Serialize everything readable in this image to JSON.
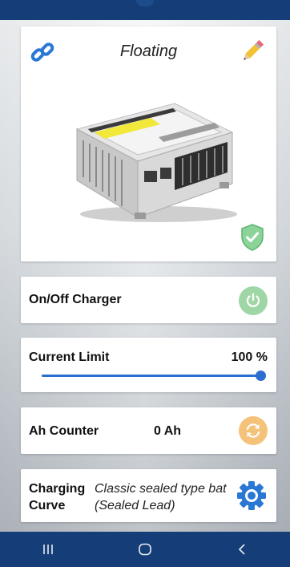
{
  "status_card": {
    "status": "Floating",
    "icons": [
      "link-icon",
      "pencil-icon",
      "shield-check-icon"
    ],
    "device_image": "battery-charger-image"
  },
  "onoff": {
    "label": "On/Off Charger",
    "icon": "power-icon",
    "color": "#9fd6a6"
  },
  "current_limit": {
    "label": "Current Limit",
    "value_text": "100 %",
    "value_percent": 100
  },
  "ah_counter": {
    "label": "Ah Counter",
    "value": "0 Ah",
    "icon": "refresh-icon",
    "color": "#f5c27a"
  },
  "charging_curve": {
    "label": "Charging Curve",
    "value": "Classic sealed type bat (Sealed Lead)",
    "icon": "gear-icon"
  },
  "nav": {
    "buttons": [
      "recent-apps-icon",
      "home-icon",
      "back-icon"
    ]
  },
  "colors": {
    "bar": "#153e78",
    "accent": "#2a6fcf"
  }
}
